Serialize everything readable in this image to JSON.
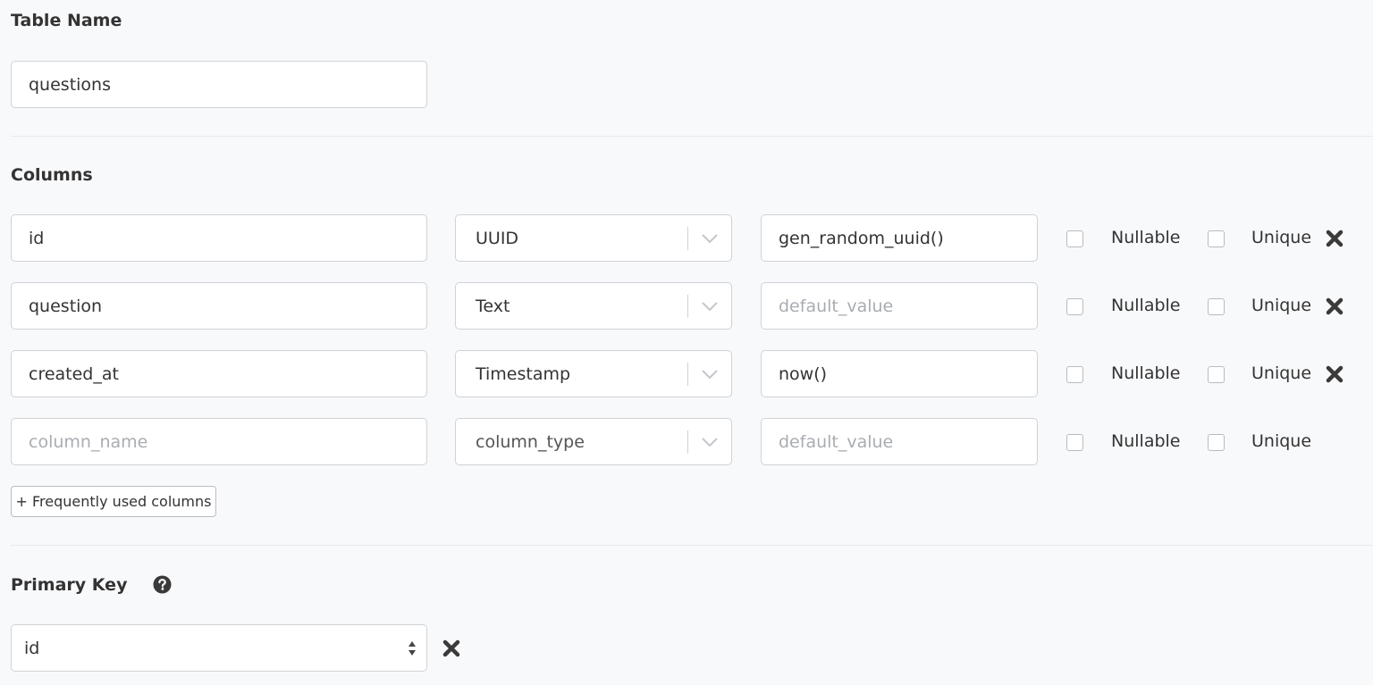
{
  "table_name": {
    "heading": "Table Name",
    "value": "questions"
  },
  "columns": {
    "heading": "Columns",
    "nullable_label": "Nullable",
    "unique_label": "Unique",
    "rows": [
      {
        "name": "id",
        "type": "UUID",
        "default": "gen_random_uuid()",
        "nullable": false,
        "unique": false
      },
      {
        "name": "question",
        "type": "Text",
        "default": "",
        "nullable": false,
        "unique": false
      },
      {
        "name": "created_at",
        "type": "Timestamp",
        "default": "now()",
        "nullable": false,
        "unique": false
      }
    ],
    "new_row": {
      "name_placeholder": "column_name",
      "type_placeholder": "column_type",
      "default_placeholder": "default_value"
    },
    "default_placeholder": "default_value",
    "frequently_used_label": "+ Frequently used columns"
  },
  "primary_key": {
    "heading": "Primary Key",
    "value": "id"
  },
  "icons": {
    "remove": "close-x-icon",
    "help": "question-circle-icon",
    "chevron": "chevron-down-icon",
    "select_arrows": "up-down-arrows-icon"
  },
  "colors": {
    "background": "#f8f9fb",
    "border": "#cfd2d6",
    "text": "#333333",
    "placeholder": "#a9adb2",
    "icon": "#3a3a3a"
  }
}
